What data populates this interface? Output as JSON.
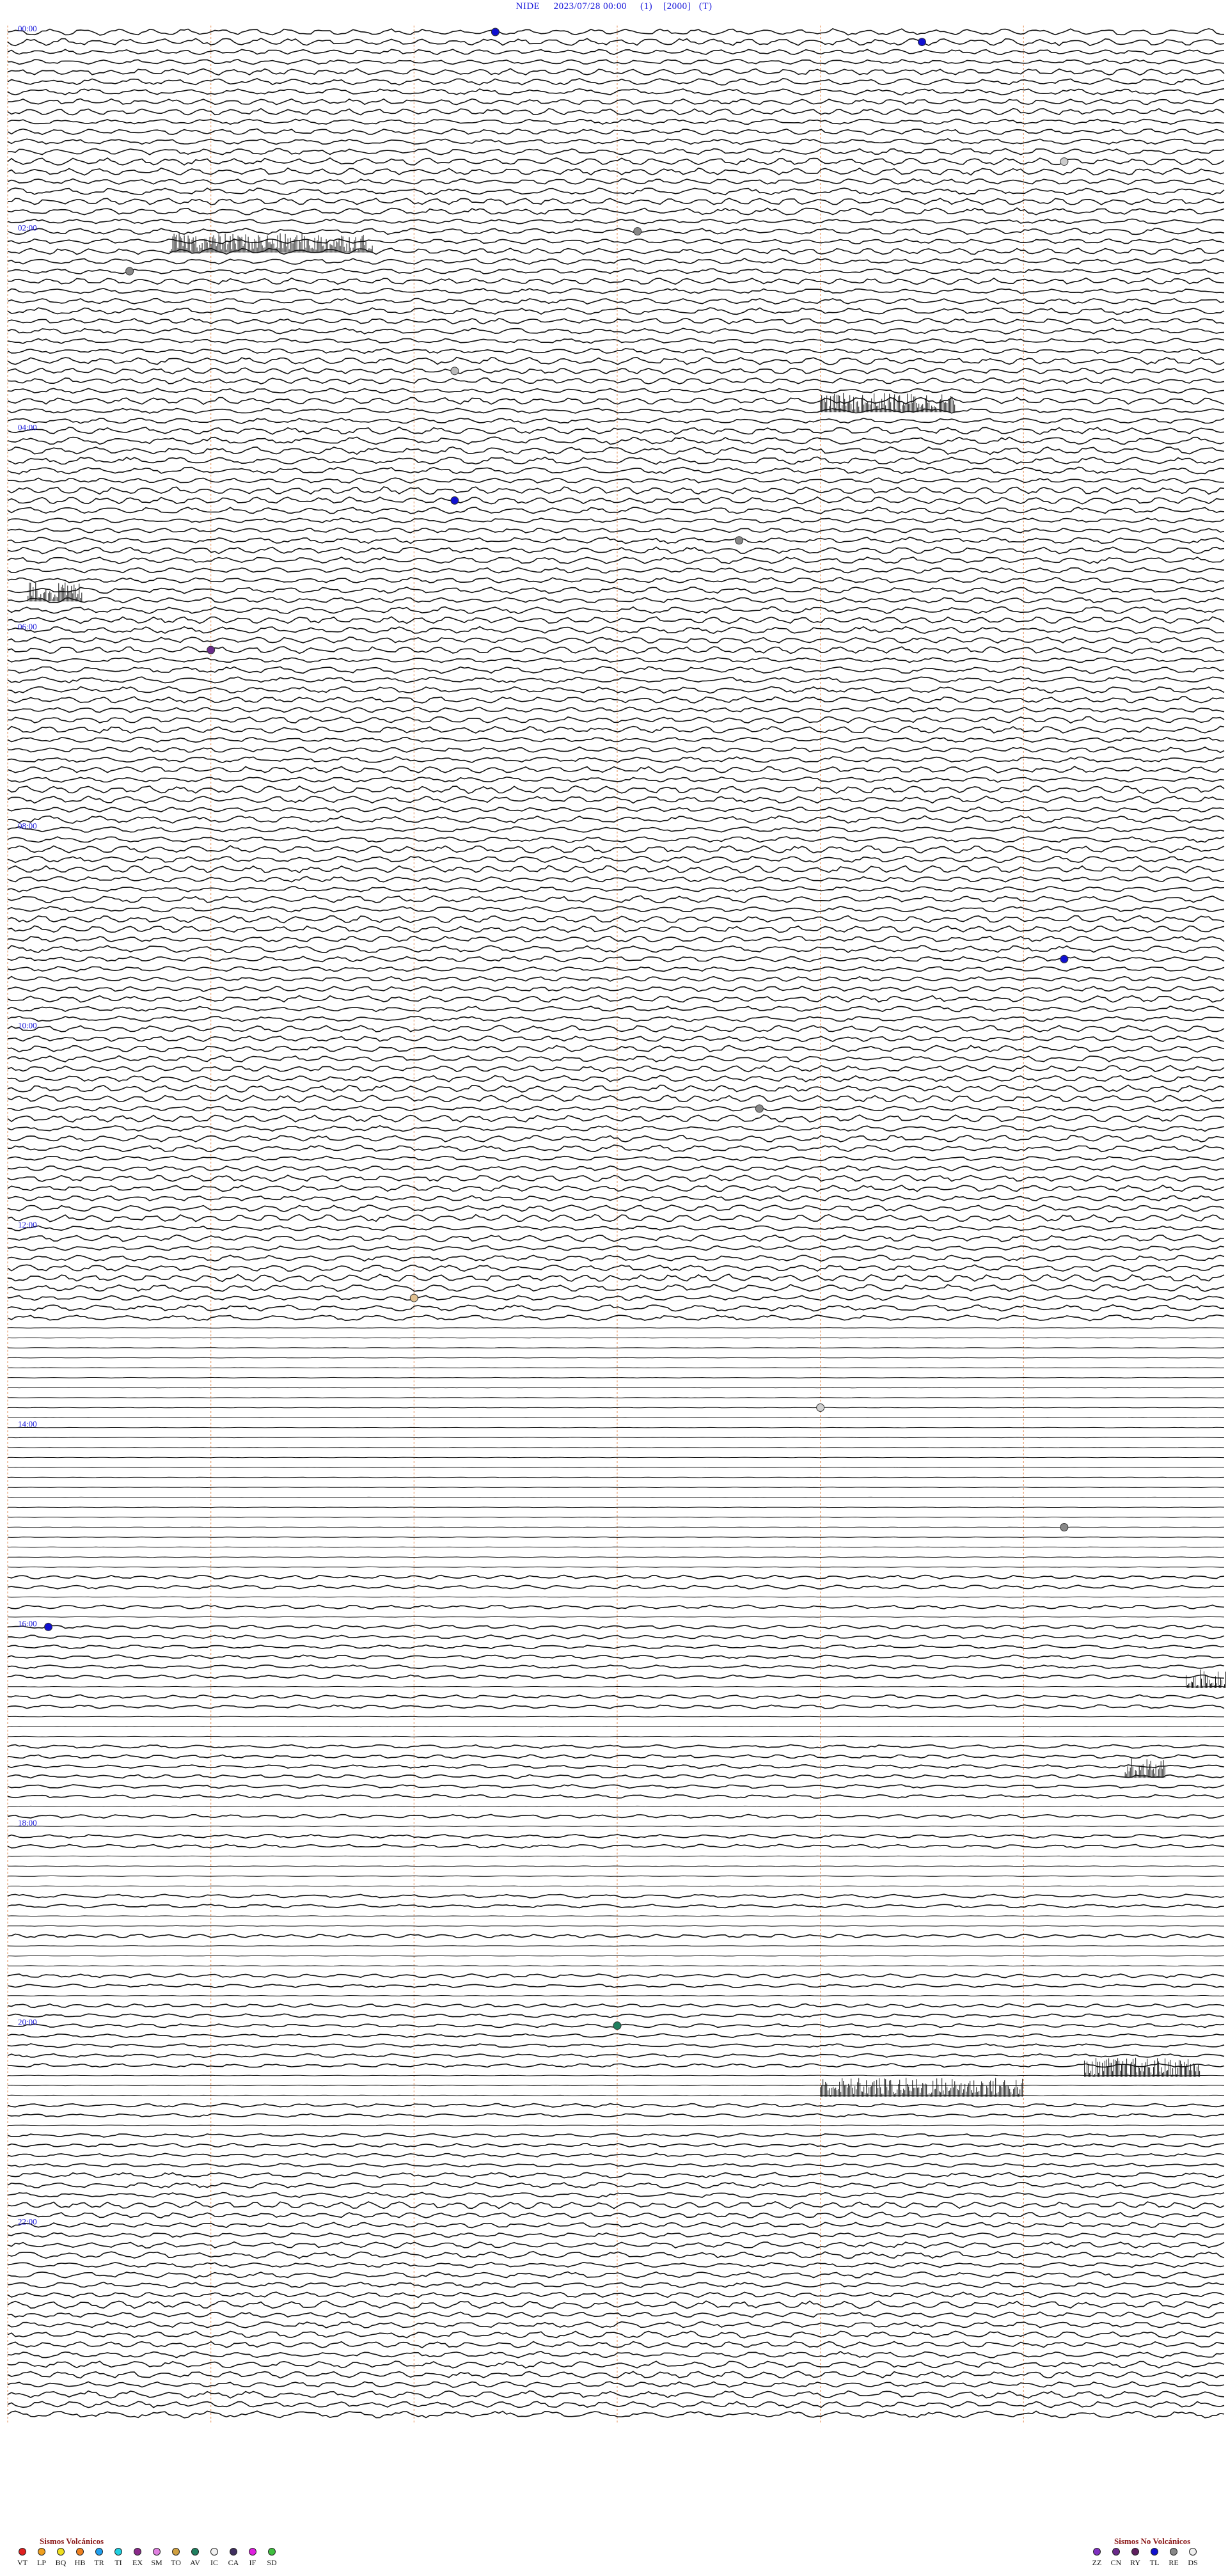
{
  "header": {
    "station": "NIDE",
    "date": "2023/07/28 00:00",
    "channel": "(1)",
    "scale": "[2000]",
    "tag": "(T)"
  },
  "hour_labels": [
    "00:00",
    "02:00",
    "04:00",
    "06:00",
    "08:00",
    "10:00",
    "12:00",
    "14:00",
    "16:00",
    "18:00",
    "20:00",
    "22:00"
  ],
  "events": [
    {
      "row": 0,
      "min": 24,
      "type": "TL",
      "color": "#1010d0"
    },
    {
      "row": 1,
      "min": 45,
      "type": "TL",
      "color": "#1010d0"
    },
    {
      "row": 13,
      "min": 52,
      "type": "DS",
      "color": "#cccccc"
    },
    {
      "row": 20,
      "min": 31,
      "type": "RE",
      "color": "#888888"
    },
    {
      "row": 24,
      "min": 6,
      "type": "RE",
      "color": "#888888"
    },
    {
      "row": 34,
      "min": 22,
      "type": "DS",
      "color": "#bbbbbb"
    },
    {
      "row": 47,
      "min": 22,
      "type": "TL",
      "color": "#1010d0"
    },
    {
      "row": 51,
      "min": 36,
      "type": "RE",
      "color": "#888888"
    },
    {
      "row": 62,
      "min": 10,
      "type": "CN",
      "color": "#6a2a8a"
    },
    {
      "row": 93,
      "min": 52,
      "type": "TL",
      "color": "#1010d0"
    },
    {
      "row": 108,
      "min": 37,
      "type": "RE",
      "color": "#888888"
    },
    {
      "row": 127,
      "min": 20,
      "type": "DS",
      "color": "#e0c090"
    },
    {
      "row": 138,
      "min": 40,
      "type": "IC",
      "color": "#d0d0d0"
    },
    {
      "row": 150,
      "min": 52,
      "type": "RE",
      "color": "#888888"
    },
    {
      "row": 160,
      "min": 2,
      "type": "TL",
      "color": "#1010d0"
    },
    {
      "row": 200,
      "min": 30,
      "type": "AV",
      "color": "#208060"
    }
  ],
  "legend": {
    "volcanic_title": "Sismos Volcánicos",
    "volcanic": [
      {
        "code": "VT",
        "color": "#e02020"
      },
      {
        "code": "LP",
        "color": "#f0a020"
      },
      {
        "code": "BQ",
        "color": "#f0e020"
      },
      {
        "code": "HB",
        "color": "#f08020"
      },
      {
        "code": "TR",
        "color": "#20a0f0"
      },
      {
        "code": "TI",
        "color": "#20d0e0"
      },
      {
        "code": "EX",
        "color": "#8a2a8a"
      },
      {
        "code": "SM",
        "color": "#e080e0"
      },
      {
        "code": "TO",
        "color": "#d0a040"
      },
      {
        "code": "AV",
        "color": "#208060"
      },
      {
        "code": "IC",
        "color": "#f0f0f0"
      },
      {
        "code": "CA",
        "color": "#403060"
      },
      {
        "code": "IF",
        "color": "#e020e0"
      },
      {
        "code": "SD",
        "color": "#40c040"
      }
    ],
    "non_volcanic_title": "Sismos No Volcánicos",
    "non_volcanic": [
      {
        "code": "ZZ",
        "color": "#8030c0"
      },
      {
        "code": "CN",
        "color": "#6a2a8a"
      },
      {
        "code": "RY",
        "color": "#602060"
      },
      {
        "code": "TL",
        "color": "#1010d0"
      },
      {
        "code": "RE",
        "color": "#888888"
      },
      {
        "code": "DS",
        "color": "#f0f0f0"
      }
    ]
  }
}
